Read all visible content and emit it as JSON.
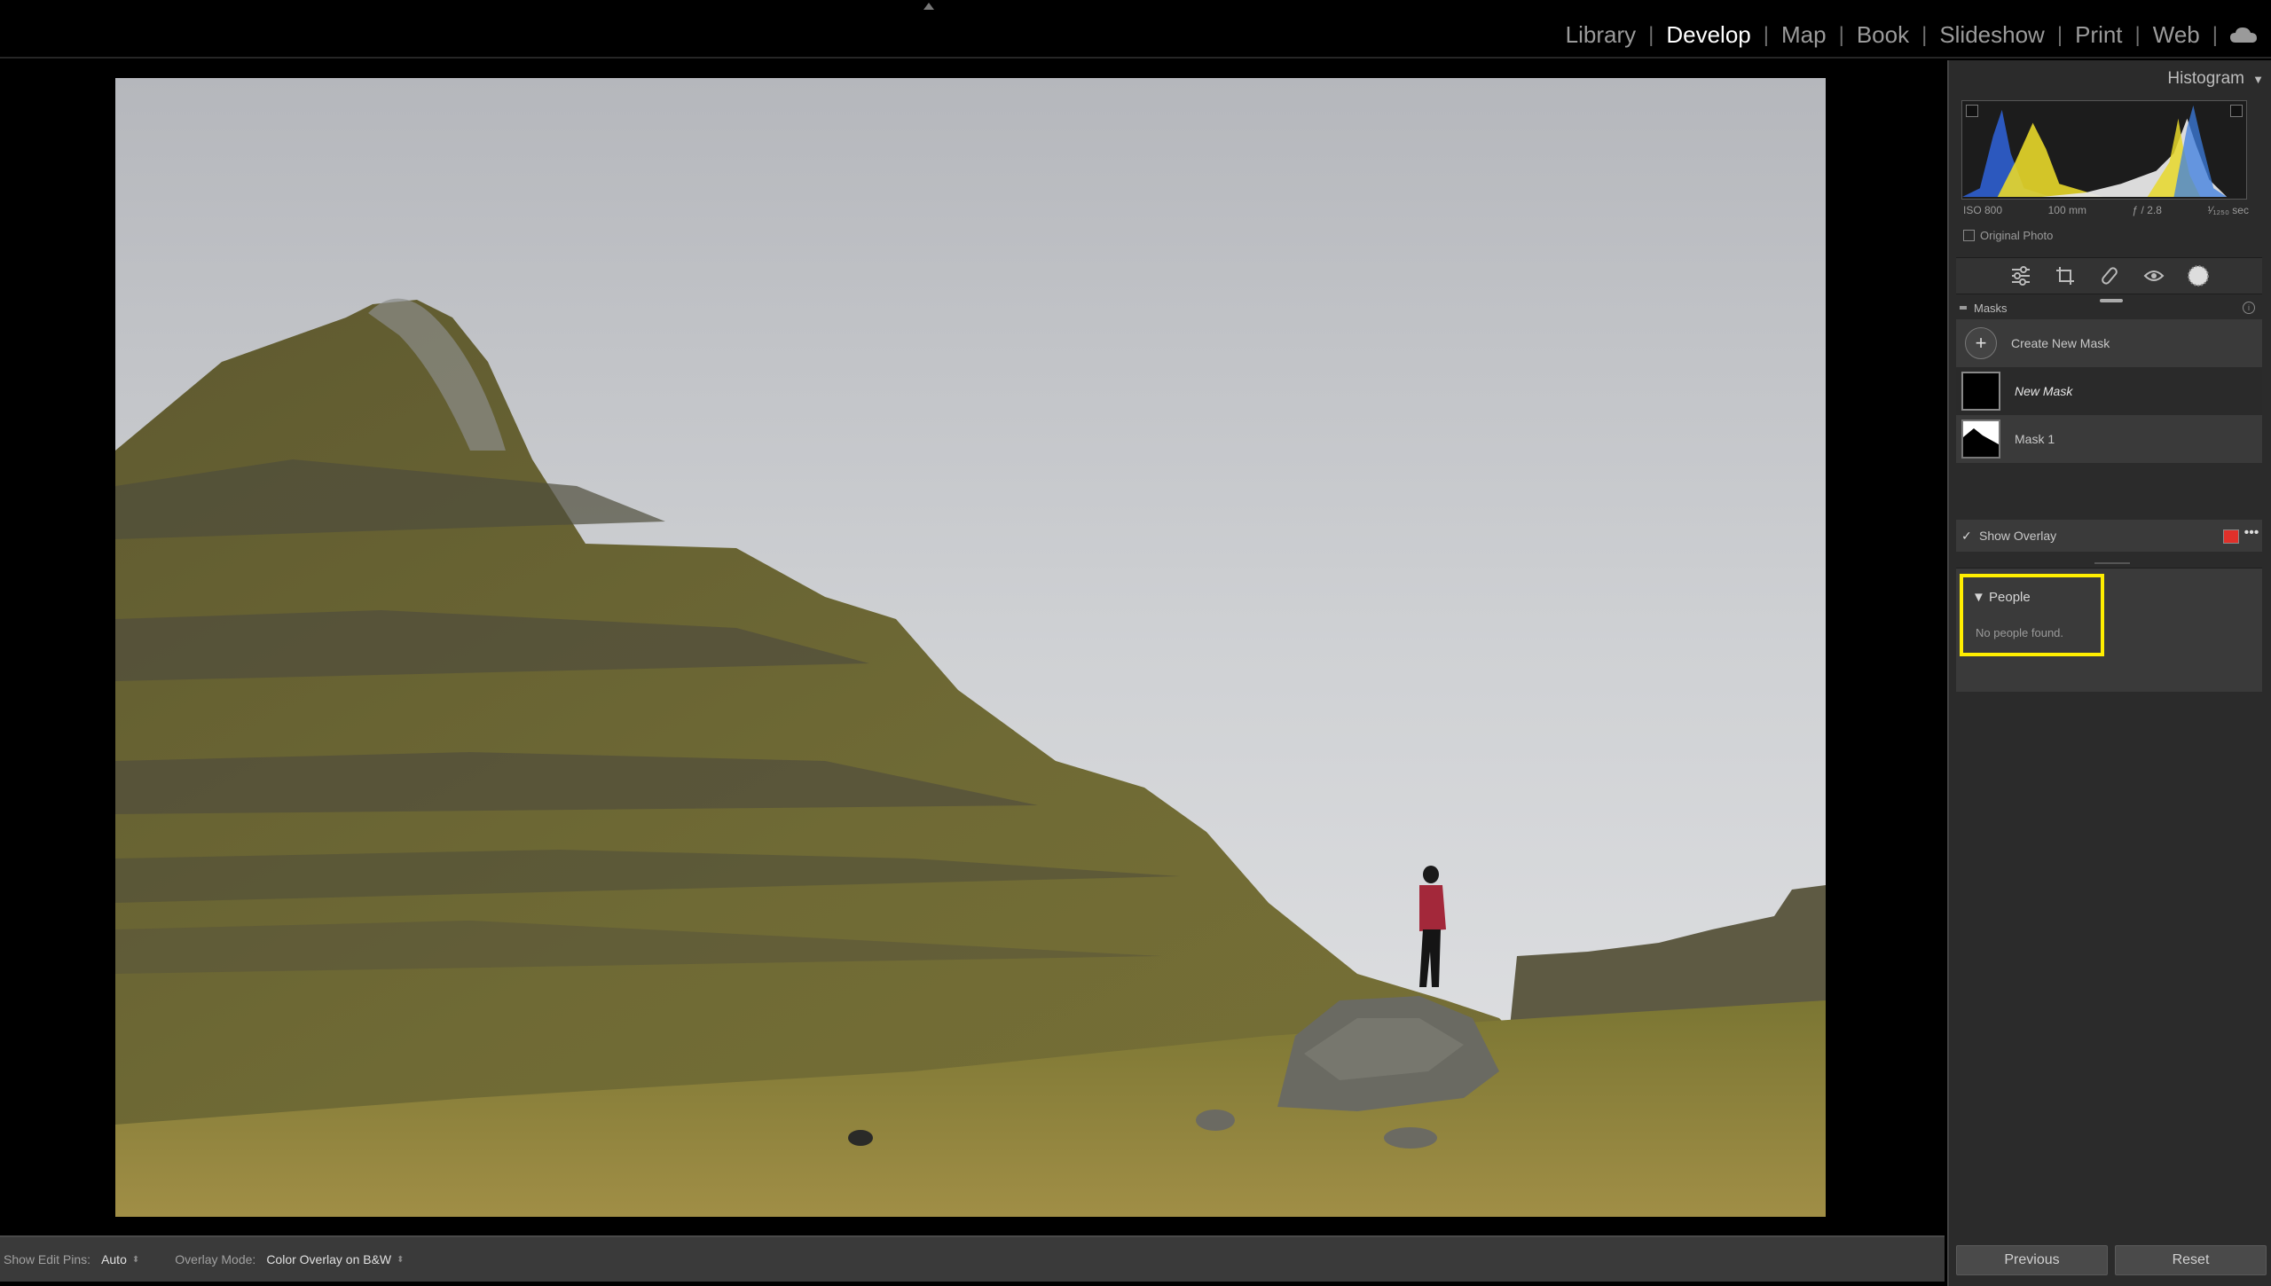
{
  "modules": [
    "Library",
    "Develop",
    "Map",
    "Book",
    "Slideshow",
    "Print",
    "Web"
  ],
  "active_module": "Develop",
  "right_panel": {
    "histogram_title": "Histogram",
    "exif": {
      "iso": "ISO 800",
      "focal": "100 mm",
      "aperture": "ƒ / 2.8",
      "shutter": "¹⁄₁₂₅₀ sec"
    },
    "original_photo_label": "Original Photo",
    "masks": {
      "header": "Masks",
      "create_label": "Create New Mask",
      "items": [
        {
          "label": "New Mask",
          "selected": true
        },
        {
          "label": "Mask 1",
          "selected": false
        }
      ],
      "show_overlay_label": "Show Overlay",
      "overlay_color": "#e0302a"
    },
    "people": {
      "title": "People",
      "empty_text": "No people found."
    },
    "buttons": {
      "previous": "Previous",
      "reset": "Reset"
    }
  },
  "toolbar": {
    "edit_pins_label": "Show Edit Pins:",
    "edit_pins_value": "Auto",
    "overlay_mode_label": "Overlay Mode:",
    "overlay_mode_value": "Color Overlay on B&W"
  },
  "colors": {
    "highlight_box": "#ffee00",
    "panel_bg": "#2b2b2b",
    "active_module": "#ffffff"
  }
}
